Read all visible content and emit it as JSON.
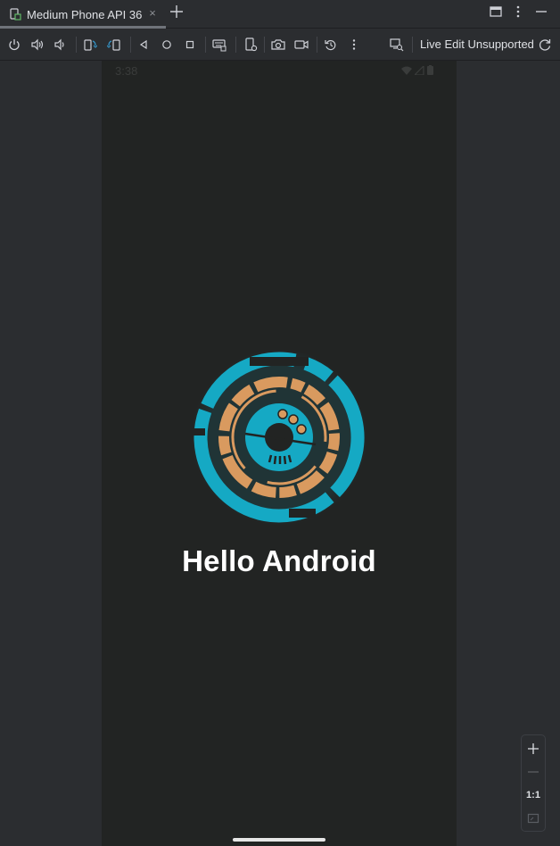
{
  "tab": {
    "title": "Medium Phone API 36",
    "close_glyph": "×"
  },
  "toolbar": {
    "live_edit_label": "Live Edit Unsupported",
    "icons": [
      "power-icon",
      "volume-up-icon",
      "volume-down-icon",
      "rotate-left-icon",
      "rotate-right-icon",
      "back-icon",
      "home-icon",
      "overview-icon",
      "keyboard-icon",
      "device-settings-icon",
      "camera-icon",
      "record-icon",
      "reset-icon",
      "more-icon",
      "snapshot-icon",
      "refresh-icon"
    ]
  },
  "phone": {
    "status_time": "3:38",
    "greeting": "Hello Android"
  },
  "zoom": {
    "actual_size_label": "1:1"
  },
  "colors": {
    "accent_teal": "#15a9c4",
    "accent_orange": "#d99a5f",
    "phone_bg": "#222423",
    "ide_bg": "#2b2d30"
  }
}
